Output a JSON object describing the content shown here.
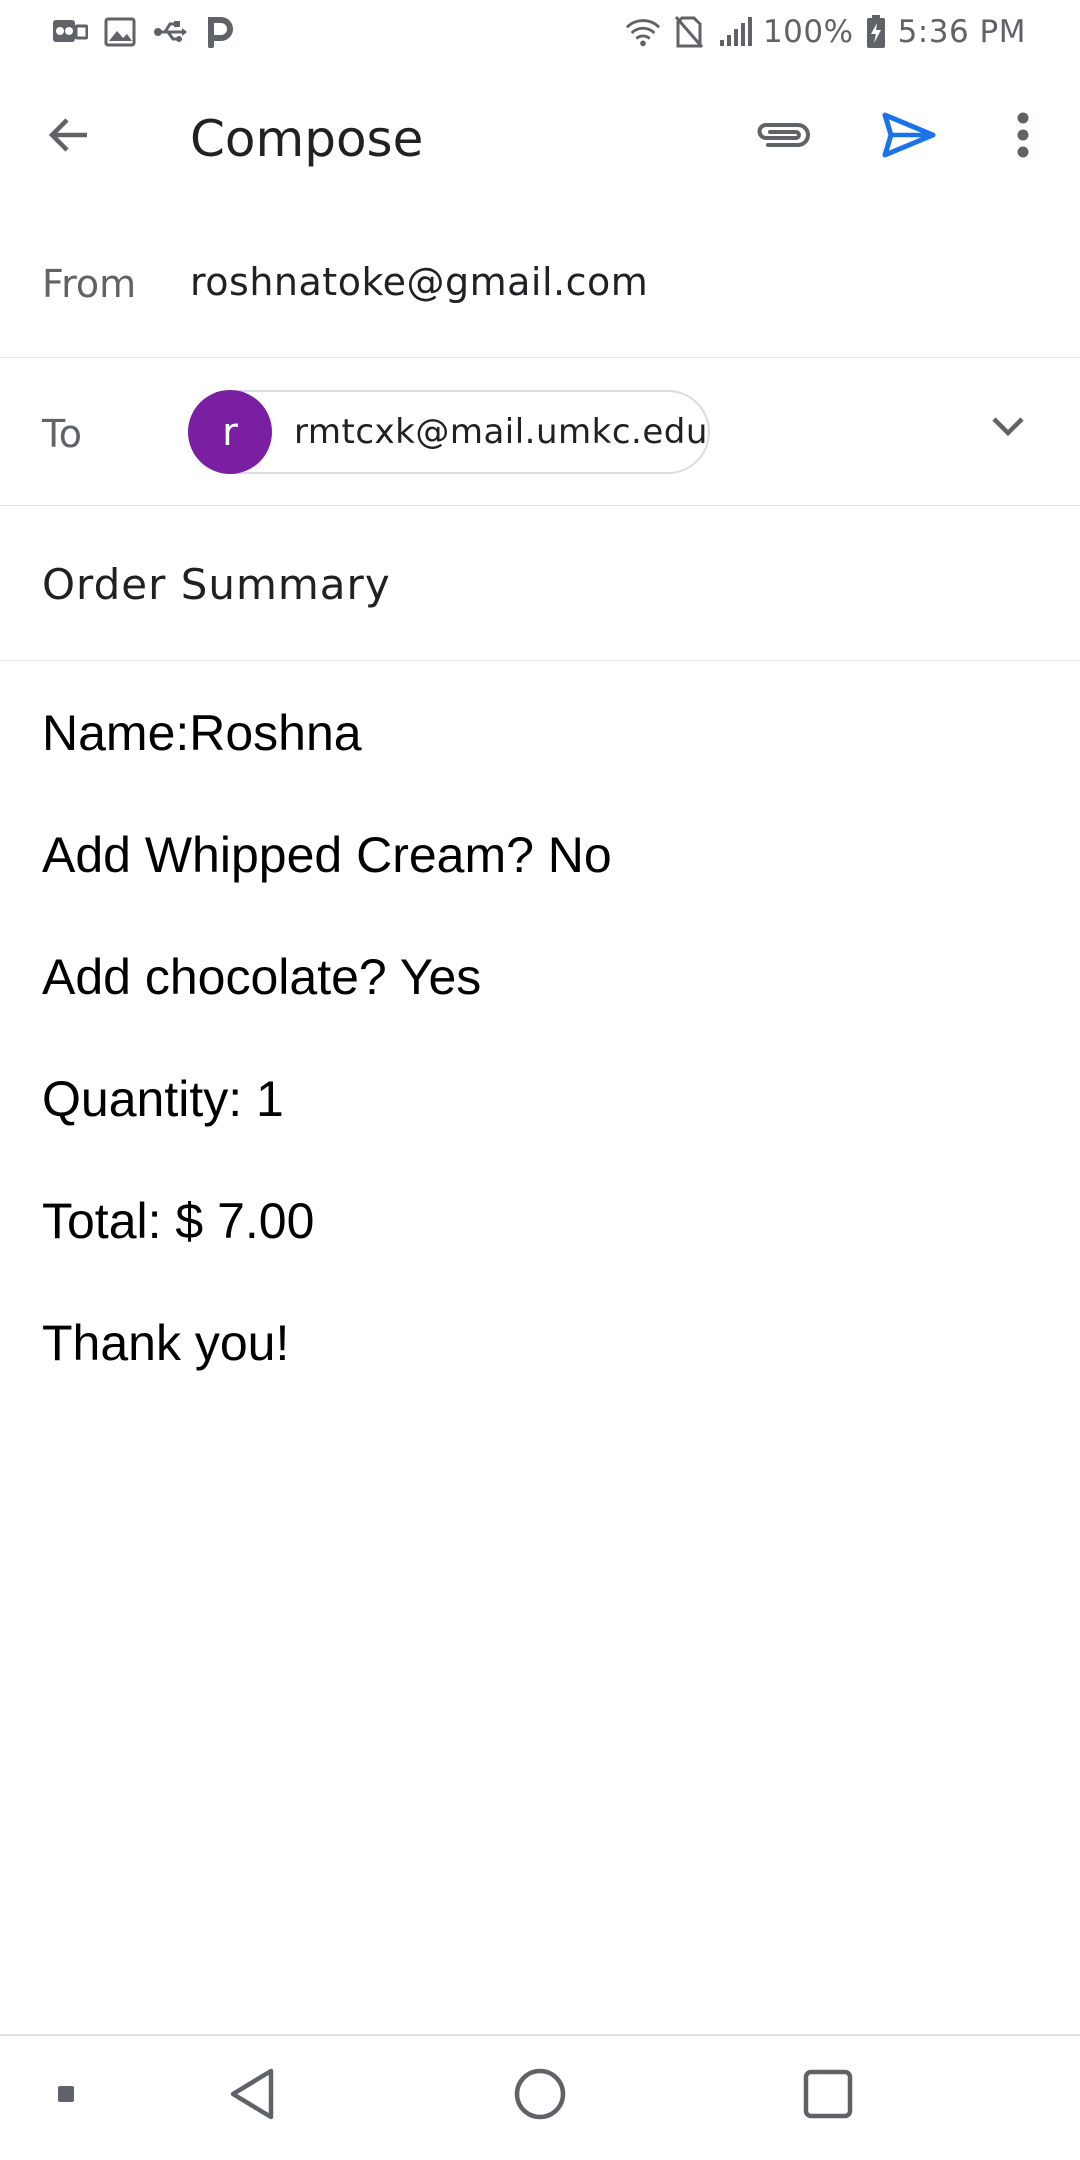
{
  "status_bar": {
    "left_icons": [
      "voicemail-icon",
      "image-icon",
      "usb-icon",
      "parking-icon"
    ],
    "right_icons": [
      "wifi-icon",
      "no-sim-icon",
      "signal-icon",
      "battery-charging-icon"
    ],
    "battery": "100%",
    "time": "5:36 PM"
  },
  "app_bar": {
    "title": "Compose",
    "icons": {
      "back": "arrow-back-icon",
      "attach": "paperclip-icon",
      "send": "send-icon",
      "more": "more-vert-icon"
    },
    "send_color": "#1a73e8"
  },
  "from": {
    "label": "From",
    "value": "roshnatoke@gmail.com"
  },
  "to": {
    "label": "To",
    "recipients": [
      {
        "initial": "r",
        "email": "rmtcxk@mail.umkc.edu",
        "avatar_color": "#7b1fa2"
      }
    ]
  },
  "subject": "Order Summary",
  "body_lines": [
    "Name:Roshna",
    "Add Whipped Cream? No",
    "Add chocolate? Yes",
    "Quantity: 1",
    "Total: $ 7.00",
    "Thank you!"
  ],
  "nav_bar": {
    "icons": [
      "dot-icon",
      "back-triangle-icon",
      "home-circle-icon",
      "recents-square-icon"
    ]
  }
}
